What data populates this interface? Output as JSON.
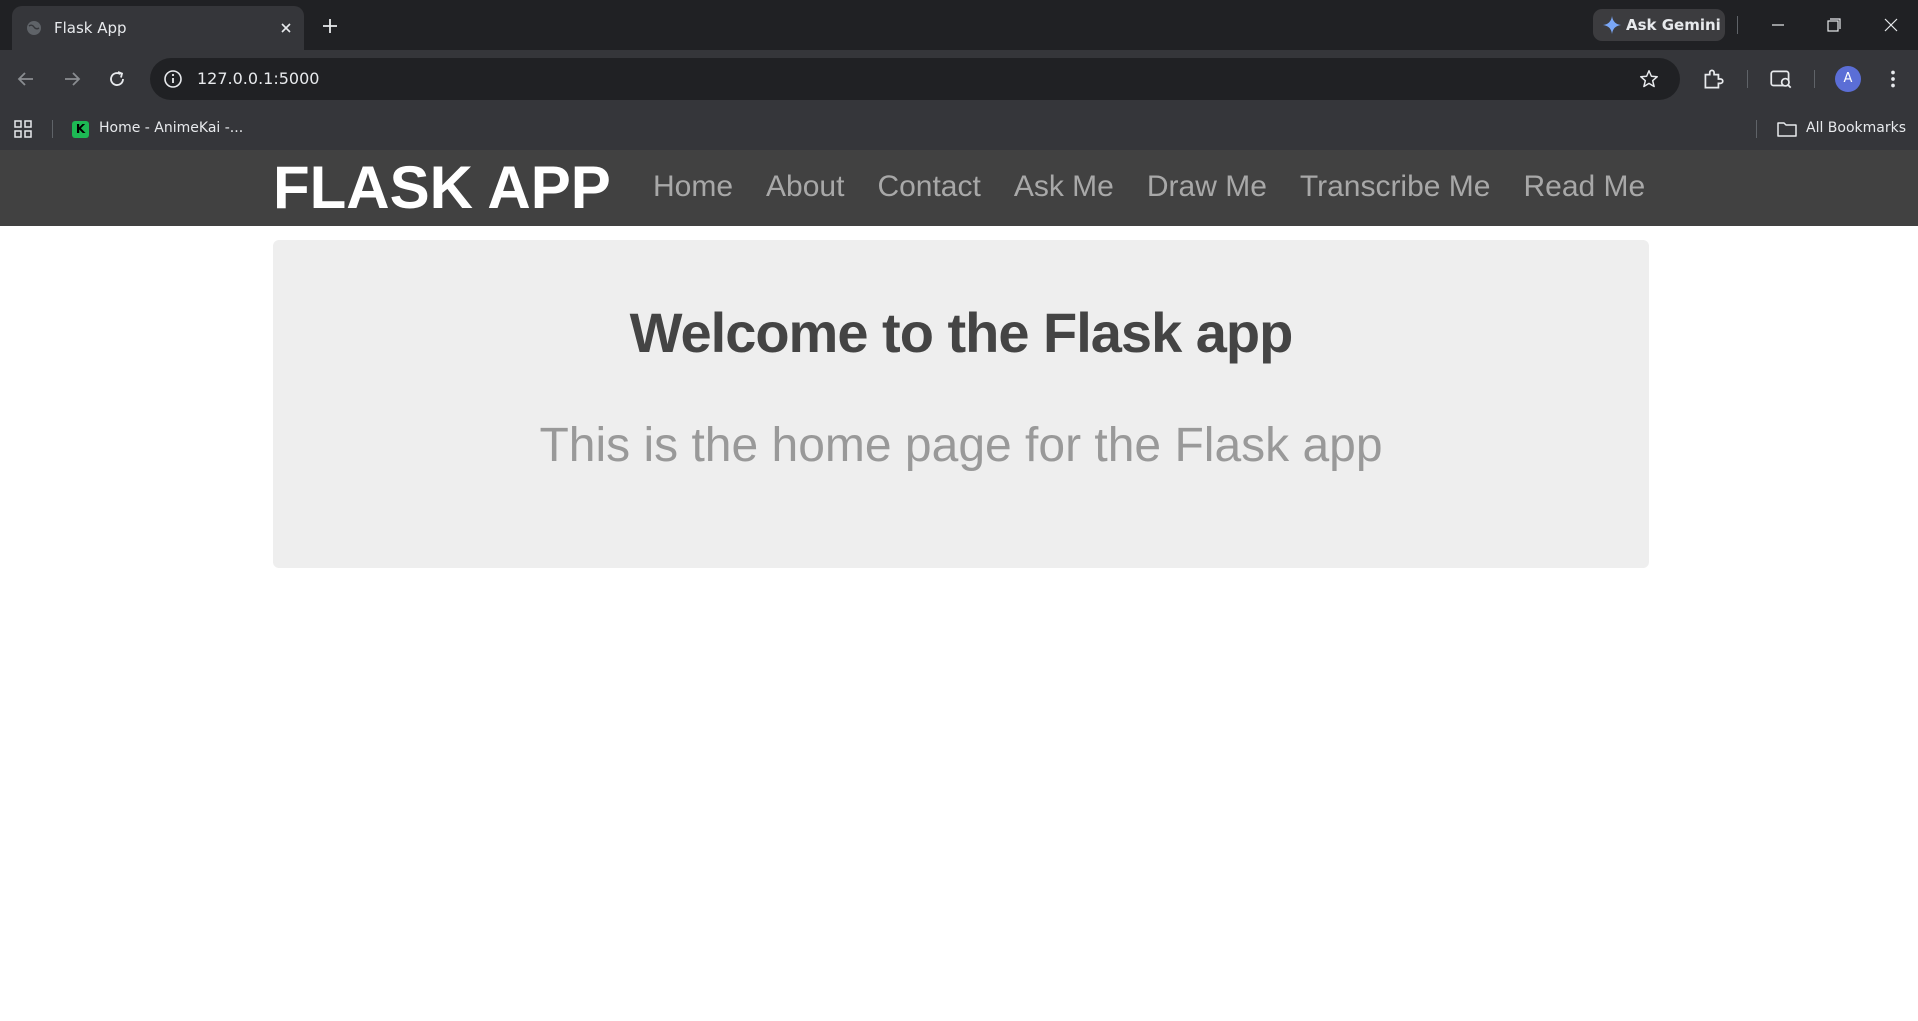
{
  "browser": {
    "tab": {
      "title": "Flask App"
    },
    "gemini_label": "Ask Gemini",
    "url": "127.0.0.1:5000",
    "avatar_letter": "A",
    "bookmarks": [
      {
        "label": "Home - AnimeKai -...",
        "favicon_letter": "K"
      }
    ],
    "all_bookmarks_label": "All Bookmarks"
  },
  "site": {
    "brand": "FLASK APP",
    "nav": [
      "Home",
      "About",
      "Contact",
      "Ask Me",
      "Draw Me",
      "Transcribe Me",
      "Read Me"
    ]
  },
  "hero": {
    "title": "Welcome to the Flask app",
    "subtitle": "This is the home page for the Flask app"
  },
  "colors": {
    "header_bg": "#414141",
    "hero_bg": "#eeeeee",
    "nav_link": "#a8a8a8",
    "hero_title": "#444444",
    "hero_subtitle": "#999999"
  }
}
